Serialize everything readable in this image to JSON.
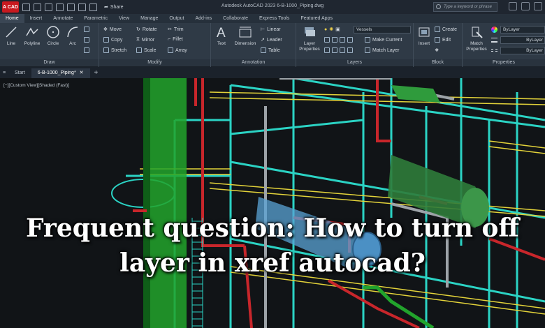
{
  "titlebar": {
    "app_badge": "A CAD",
    "share_label": "Share",
    "window_title": "Autodesk AutoCAD 2023    6-B-1000_Piping.dwg",
    "search_placeholder": "Type a keyword or phrase"
  },
  "ribbon_tabs": [
    "Home",
    "Insert",
    "Annotate",
    "Parametric",
    "View",
    "Manage",
    "Output",
    "Add-ins",
    "Collaborate",
    "Express Tools",
    "Featured Apps"
  ],
  "ribbon": {
    "draw": {
      "title": "Draw",
      "tools": [
        "Line",
        "Polyline",
        "Circle",
        "Arc"
      ]
    },
    "modify": {
      "title": "Modify",
      "rows": [
        [
          "Move",
          "Rotate",
          "Trim"
        ],
        [
          "Copy",
          "Mirror",
          "Fillet"
        ],
        [
          "Stretch",
          "Scale",
          "Array"
        ]
      ]
    },
    "annotation": {
      "title": "Annotation",
      "big": [
        "Text",
        "Dimension"
      ],
      "rows": [
        "Linear",
        "Leader",
        "Table"
      ]
    },
    "layers": {
      "title": "Layers",
      "big": "Layer Properties",
      "layer_name": "Vessels",
      "rows": [
        "Make Current",
        "Match Layer"
      ]
    },
    "block": {
      "title": "Block",
      "big": "Insert",
      "rows": [
        "Create",
        "Edit"
      ]
    },
    "properties": {
      "title": "Properties",
      "big": "Match Properties",
      "values": [
        "ByLayer",
        "ByLayer",
        "ByLayer"
      ]
    }
  },
  "doc_tabs": {
    "start": "Start",
    "active": "6-B-1000_Piping*"
  },
  "viewport": {
    "view_label": "[−][Custom View][Shaded (Fast)]"
  },
  "headline": "Frequent question: How to turn off layer in xref autocad?",
  "colors": {
    "structure": "#2bd3c4",
    "rails": "#e3d33a",
    "pipe_red": "#c8262b",
    "pipe_green": "#22a32c",
    "vessel": "#5aa3d6"
  }
}
